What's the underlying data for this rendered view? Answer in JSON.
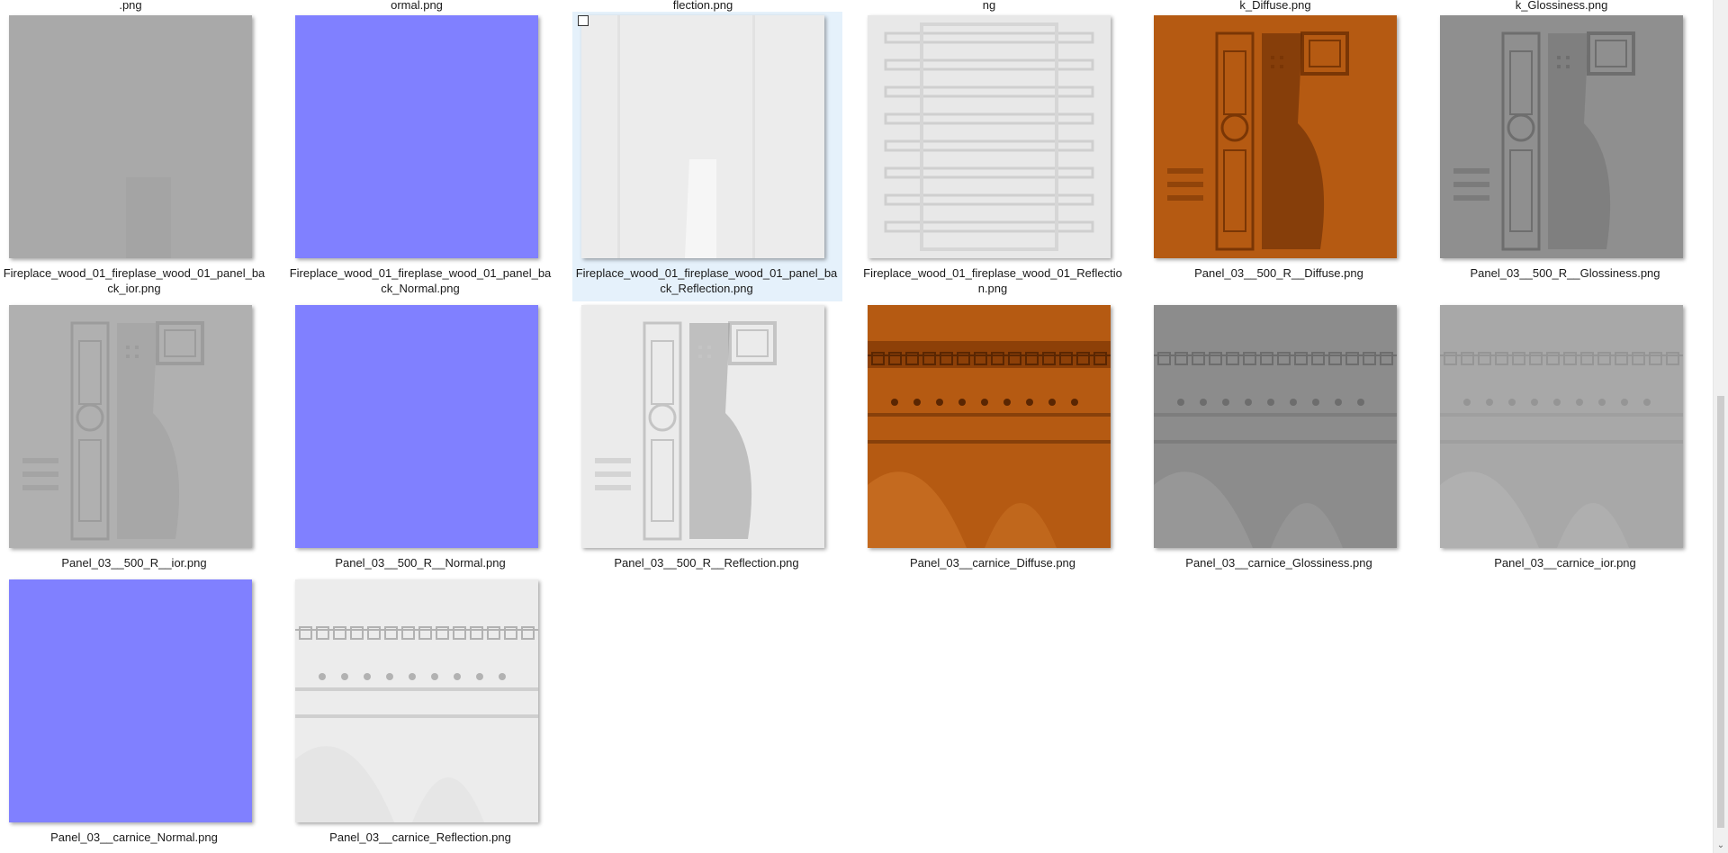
{
  "cut_labels": [
    ".png",
    "ormal.png",
    "flection.png",
    "ng",
    "k_Diffuse.png",
    "k_Glossiness.png"
  ],
  "files": [
    {
      "name": "Fireplace_wood_01_fireplase_wood_01_panel_back_ior.png",
      "kind": "gray-flat",
      "selected": false
    },
    {
      "name": "Fireplace_wood_01_fireplase_wood_01_panel_back_Normal.png",
      "kind": "normal",
      "selected": false
    },
    {
      "name": "Fireplace_wood_01_fireplase_wood_01_panel_back_Reflection.png",
      "kind": "light-flat",
      "selected": true
    },
    {
      "name": "Fireplace_wood_01_fireplase_wood_01_Reflection.png",
      "kind": "light-pattern",
      "selected": false
    },
    {
      "name": "Panel_03__500_R__Diffuse.png",
      "kind": "wood-panel",
      "selected": false
    },
    {
      "name": "Panel_03__500_R__Glossiness.png",
      "kind": "gray-panel",
      "selected": false
    },
    {
      "name": "Panel_03__500_R__ior.png",
      "kind": "gray-panel-light",
      "selected": false
    },
    {
      "name": "Panel_03__500_R__Normal.png",
      "kind": "normal",
      "selected": false
    },
    {
      "name": "Panel_03__500_R__Reflection.png",
      "kind": "light-panel",
      "selected": false
    },
    {
      "name": "Panel_03__carnice_Diffuse.png",
      "kind": "wood-cornice",
      "selected": false
    },
    {
      "name": "Panel_03__carnice_Glossiness.png",
      "kind": "gray-cornice",
      "selected": false
    },
    {
      "name": "Panel_03__carnice_ior.png",
      "kind": "gray-cornice-light",
      "selected": false
    },
    {
      "name": "Panel_03__carnice_Normal.png",
      "kind": "normal",
      "selected": false
    },
    {
      "name": "Panel_03__carnice_Reflection.png",
      "kind": "light-cornice",
      "selected": false
    }
  ],
  "colors": {
    "normal": "#8080ff",
    "gray_flat": "#a9a9a9",
    "wood": "#b55a12",
    "wood_dark": "#7a3605",
    "selection": "#e5f1fb"
  },
  "scrollbar": {
    "down_arrow_icon": "chevron-down-icon"
  }
}
